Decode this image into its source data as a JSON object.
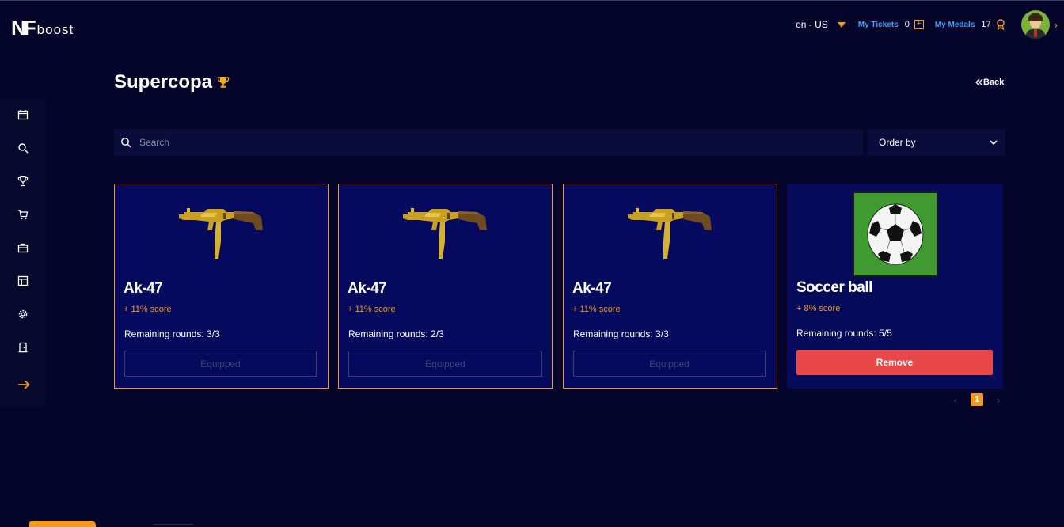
{
  "header": {
    "logo_mark": "NF",
    "logo_word": "boost",
    "language": "en - US",
    "tickets_label": "My Tickets",
    "tickets_count": "0",
    "medals_label": "My Medals",
    "medals_count": "17"
  },
  "sidebar": {
    "items": [
      {
        "icon": "calendar-icon"
      },
      {
        "icon": "search-icon"
      },
      {
        "icon": "trophy-icon"
      },
      {
        "icon": "cart-icon"
      },
      {
        "icon": "bag-icon"
      },
      {
        "icon": "table-icon"
      },
      {
        "icon": "gear-icon"
      },
      {
        "icon": "door-icon"
      },
      {
        "icon": "arrow-right-icon"
      }
    ]
  },
  "page": {
    "title": "Supercopa",
    "back_label": "Back"
  },
  "search": {
    "placeholder": "Search",
    "value": ""
  },
  "order": {
    "label": "Order by"
  },
  "cards": [
    {
      "name": "Ak-47",
      "score": "+ 11% score",
      "rounds": "Remaining rounds: 3/3",
      "button": "Equipped",
      "image": "ak47-gold"
    },
    {
      "name": "Ak-47",
      "score": "+ 11% score",
      "rounds": "Remaining rounds: 2/3",
      "button": "Equipped",
      "image": "ak47-gold"
    },
    {
      "name": "Ak-47",
      "score": "+ 11% score",
      "rounds": "Remaining rounds: 3/3",
      "button": "Equipped",
      "image": "ak47-gold"
    },
    {
      "name": "Soccer ball",
      "score": "+ 8% score",
      "rounds": "Remaining rounds: 5/5",
      "button": "Remove",
      "image": "soccer-ball"
    }
  ],
  "pagination": {
    "current": "1"
  },
  "colors": {
    "background": "#05052b",
    "card": "#050a5e",
    "accent": "#f29a1e",
    "link": "#3fa0ff",
    "remove": "#e84848"
  }
}
